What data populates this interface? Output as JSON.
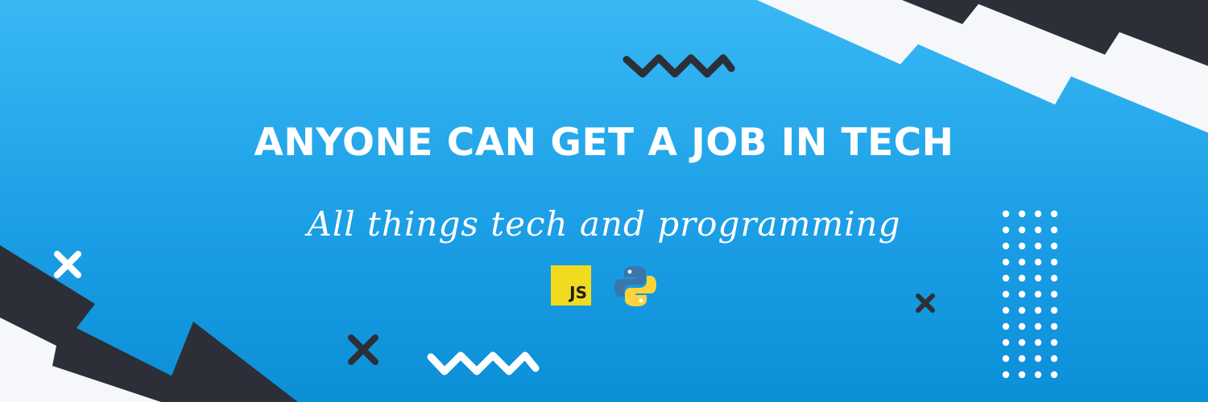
{
  "banner": {
    "headline": "ANYONE CAN GET A JOB IN TECH",
    "tagline": "All things tech and programming"
  },
  "logos": {
    "javascript": {
      "text": "JS",
      "icon": "javascript-logo-icon",
      "color": "#F0DB1E"
    },
    "python": {
      "icon": "python-logo-icon",
      "colors": [
        "#3B76AB",
        "#FFD43B"
      ]
    }
  },
  "colors": {
    "background_top": "#38B8F4",
    "background_bottom": "#0B8FD6",
    "dark": "#2C2F38",
    "light": "#F5F7FA",
    "text": "#FFFFFF"
  }
}
